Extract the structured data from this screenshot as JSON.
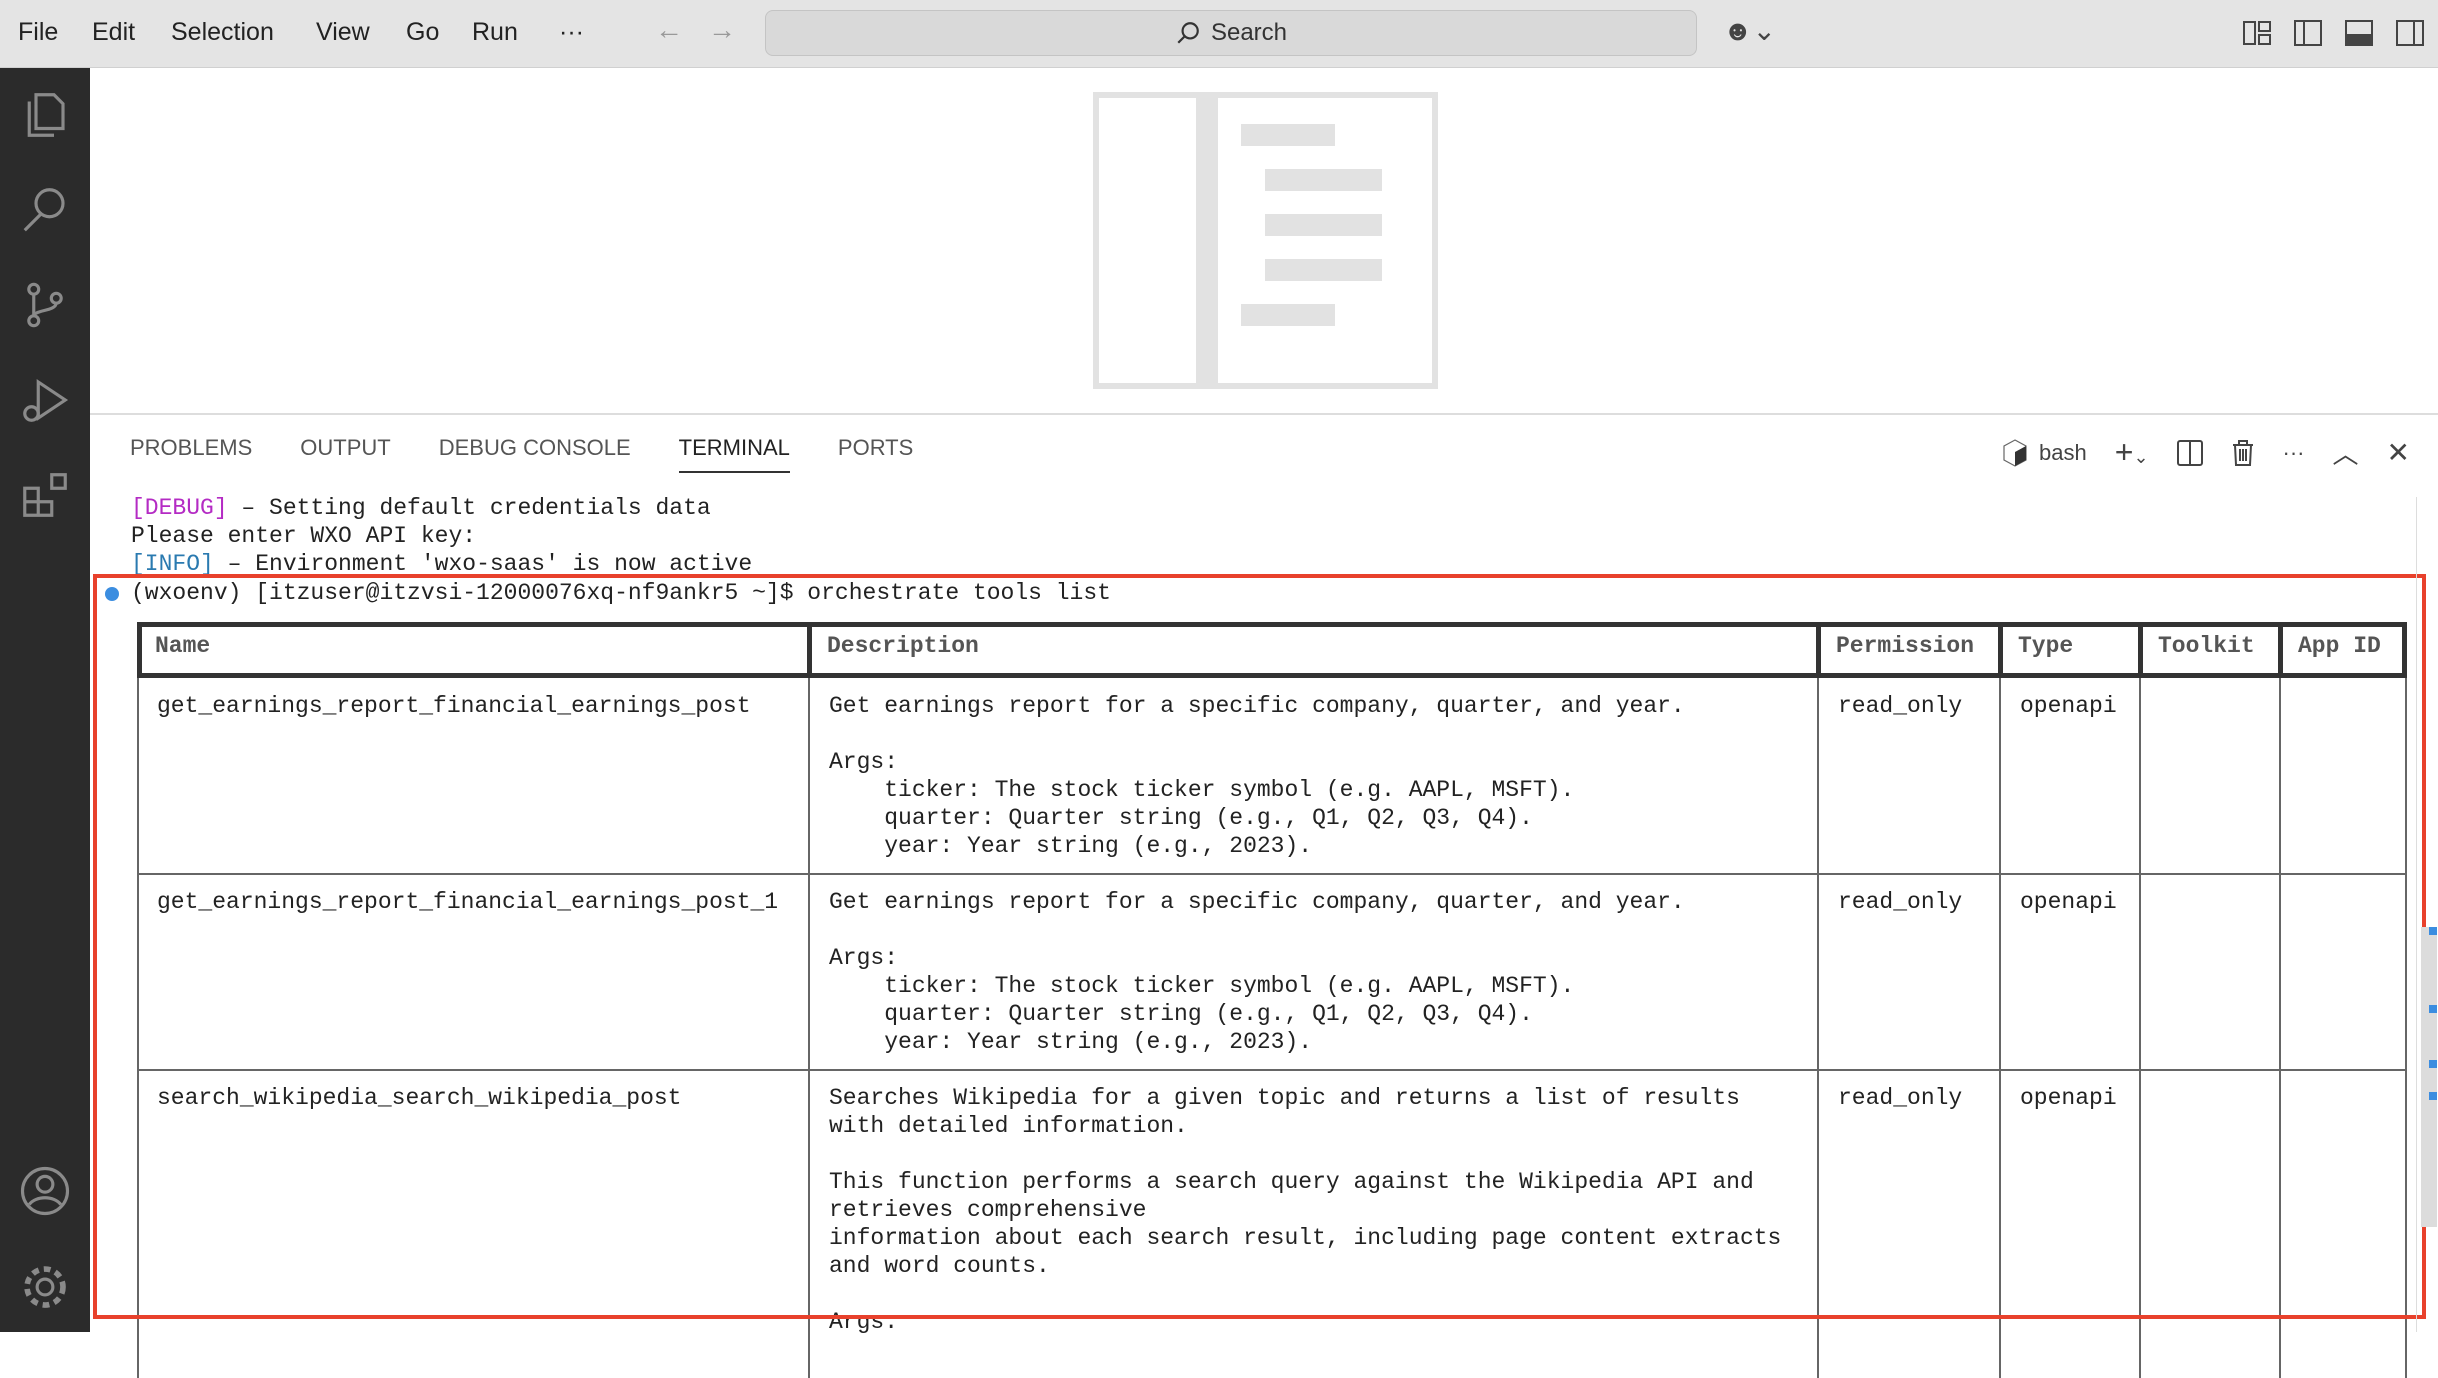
{
  "menu": [
    "File",
    "Edit",
    "Selection",
    "View",
    "Go",
    "Run",
    "···"
  ],
  "search": {
    "label": "Search"
  },
  "panel": {
    "tabs": [
      "PROBLEMS",
      "OUTPUT",
      "DEBUG CONSOLE",
      "TERMINAL",
      "PORTS"
    ],
    "active": "TERMINAL",
    "shell": "bash"
  },
  "terminal": {
    "lines": [
      {
        "tag": "[DEBUG]",
        "tag_color": "#b42bc4",
        "text": " – Setting default credentials data"
      },
      {
        "tag": "",
        "text": "Please enter WXO API key:"
      },
      {
        "tag": "[INFO]",
        "tag_color": "#2a7ab0",
        "text": " – Environment 'wxo-saas' is now active"
      }
    ],
    "prompt": "(wxoenv) [itzuser@itzvsi-12000076xq-nf9ankr5 ~]$ orchestrate tools list"
  },
  "table": {
    "headers": [
      "Name",
      "Description",
      "Permission",
      "Type",
      "Toolkit",
      "App ID"
    ],
    "rows": [
      {
        "name": "get_earnings_report_financial_earnings_post",
        "description": "Get earnings report for a specific company, quarter, and year.\n\nArgs:\n    ticker: The stock ticker symbol (e.g. AAPL, MSFT).\n    quarter: Quarter string (e.g., Q1, Q2, Q3, Q4).\n    year: Year string (e.g., 2023).",
        "permission": "read_only",
        "type": "openapi",
        "toolkit": "",
        "app_id": ""
      },
      {
        "name": "get_earnings_report_financial_earnings_post_1",
        "description": "Get earnings report for a specific company, quarter, and year.\n\nArgs:\n    ticker: The stock ticker symbol (e.g. AAPL, MSFT).\n    quarter: Quarter string (e.g., Q1, Q2, Q3, Q4).\n    year: Year string (e.g., 2023).",
        "permission": "read_only",
        "type": "openapi",
        "toolkit": "",
        "app_id": ""
      },
      {
        "name": "search_wikipedia_search_wikipedia_post",
        "description": "Searches Wikipedia for a given topic and returns a list of results\nwith detailed information.\n\nThis function performs a search query against the Wikipedia API and\nretrieves comprehensive\ninformation about each search result, including page content extracts\nand word counts.\n\nArgs:",
        "permission": "read_only",
        "type": "openapi",
        "toolkit": "",
        "app_id": ""
      }
    ]
  },
  "colors": {
    "highlight_box": "#e8412c",
    "activity_bar": "#2b2b2b"
  }
}
